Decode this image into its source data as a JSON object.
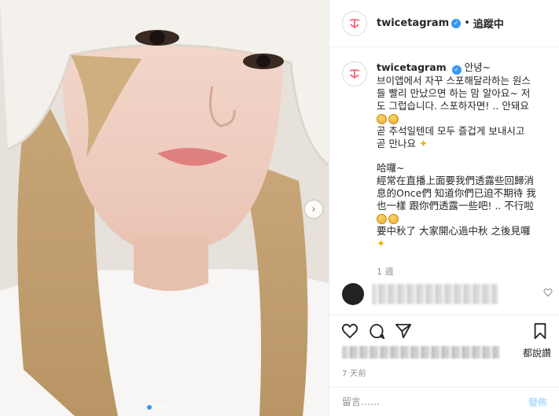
{
  "post": {
    "username": "twicetagram",
    "follow_label": "追蹤中",
    "separator": "•",
    "image_count": 3,
    "active_image": 1,
    "next_arrow": "›"
  },
  "caption": {
    "username": "twicetagram",
    "first_line": "안녕~",
    "lines_kr": [
      "브이앱에서 자꾸 스포해달라하는 원스",
      "들 빨리 만났으면 하는 맘 알아요~ 저",
      "도 그럽습니다. 스포하자면! .. 안돼요"
    ],
    "lines_kr2": [
      "곧 추석일텐데 모두 즐겁게 보내시고",
      "곧 만나요"
    ],
    "lines_zh": [
      "哈囉~",
      "經常在直播上面要我們透露些回歸消",
      "息的Once們 知道你們已迫不期待 我",
      "也一樣 跟你們透露一些吧! .. 不行啦"
    ],
    "lines_zh2": "要中秋了 大家開心過中秋 之後見囉"
  },
  "caption_time": "1 週",
  "comment": {
    "heart_icon": "heart-outline"
  },
  "likes": {
    "suffix": "都說讚"
  },
  "posted_ago": "7 天前",
  "comment_input": {
    "placeholder": "留言……",
    "post_label": "發佈"
  },
  "colors": {
    "accent": "#3897f0",
    "brand": "#ff5f7e",
    "muted": "#8e8e8e",
    "post_disabled": "#b2dffc"
  }
}
